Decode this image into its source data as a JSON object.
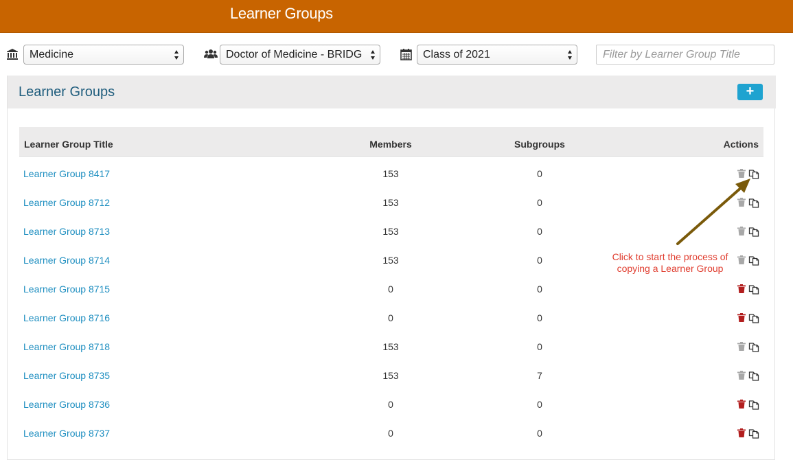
{
  "app": {
    "title": "Learner Groups"
  },
  "filters": {
    "school": "Medicine",
    "program": "Doctor of Medicine - BRIDG",
    "cohort": "Class of 2021",
    "search_placeholder": "Filter by Learner Group Title"
  },
  "panel": {
    "title": "Learner Groups",
    "add_label": "+"
  },
  "table": {
    "headers": {
      "title": "Learner Group Title",
      "members": "Members",
      "subgroups": "Subgroups",
      "actions": "Actions"
    },
    "rows": [
      {
        "title": "Learner Group 8417",
        "members": "153",
        "subgroups": "0",
        "trash_color": "#a8a8a8"
      },
      {
        "title": "Learner Group 8712",
        "members": "153",
        "subgroups": "0",
        "trash_color": "#a8a8a8"
      },
      {
        "title": "Learner Group 8713",
        "members": "153",
        "subgroups": "0",
        "trash_color": "#a8a8a8"
      },
      {
        "title": "Learner Group 8714",
        "members": "153",
        "subgroups": "0",
        "trash_color": "#a8a8a8"
      },
      {
        "title": "Learner Group 8715",
        "members": "0",
        "subgroups": "0",
        "trash_color": "#b21e1e"
      },
      {
        "title": "Learner Group 8716",
        "members": "0",
        "subgroups": "0",
        "trash_color": "#b21e1e"
      },
      {
        "title": "Learner Group 8718",
        "members": "153",
        "subgroups": "0",
        "trash_color": "#a8a8a8"
      },
      {
        "title": "Learner Group 8735",
        "members": "153",
        "subgroups": "7",
        "trash_color": "#a8a8a8"
      },
      {
        "title": "Learner Group 8736",
        "members": "0",
        "subgroups": "0",
        "trash_color": "#b21e1e"
      },
      {
        "title": "Learner Group 8737",
        "members": "0",
        "subgroups": "0",
        "trash_color": "#b21e1e"
      }
    ]
  },
  "annotation": {
    "text": "Click to start the process of copying a Learner Group",
    "color": "#e03c2e",
    "arrow_color": "#7a5a0a"
  },
  "colors": {
    "header_bg": "#c86400",
    "link": "#1d8ec0",
    "panel_title": "#1f5d7d",
    "add_button": "#1fa3d0"
  }
}
